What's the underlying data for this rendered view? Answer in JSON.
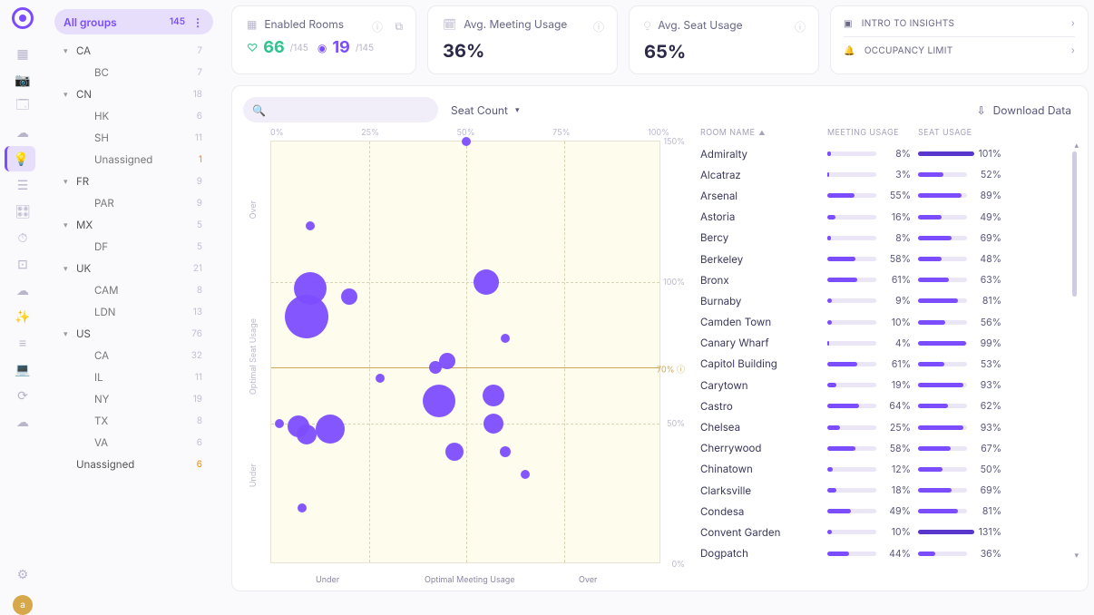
{
  "rail": {
    "avatar_letter": "a",
    "items": [
      {
        "icon": "▦",
        "name": "rooms-icon"
      },
      {
        "icon": "📷",
        "name": "camera-icon"
      },
      {
        "icon": "🗔",
        "name": "screens-icon"
      },
      {
        "icon": "☁",
        "name": "cloud1-icon"
      },
      {
        "icon": "💡",
        "name": "insights-icon",
        "selected": true
      },
      {
        "icon": "☰",
        "name": "list1-icon"
      },
      {
        "icon": "🎛",
        "name": "controls-icon"
      },
      {
        "icon": "⏱",
        "name": "time-icon"
      },
      {
        "icon": "⊡",
        "name": "box-icon"
      },
      {
        "icon": "☁",
        "name": "cloud2-icon"
      },
      {
        "icon": "✨",
        "name": "spark-icon"
      },
      {
        "icon": "≡",
        "name": "list2-icon"
      },
      {
        "icon": "💻",
        "name": "device-icon"
      },
      {
        "icon": "⟳",
        "name": "sync-icon"
      },
      {
        "icon": "☁",
        "name": "cloud3-icon"
      }
    ],
    "settings_icon": "⚙"
  },
  "tree": {
    "header": {
      "label": "All groups",
      "count": "145",
      "more": "⋮"
    },
    "items": [
      {
        "label": "CA",
        "count": "7",
        "expandable": true
      },
      {
        "label": "BC",
        "count": "7",
        "sub": true
      },
      {
        "label": "CN",
        "count": "18",
        "expandable": true
      },
      {
        "label": "HK",
        "count": "6",
        "sub": true
      },
      {
        "label": "SH",
        "count": "11",
        "sub": true
      },
      {
        "label": "Unassigned",
        "count": "1",
        "sub": true,
        "orange": true
      },
      {
        "label": "FR",
        "count": "9",
        "expandable": true
      },
      {
        "label": "PAR",
        "count": "9",
        "sub": true
      },
      {
        "label": "MX",
        "count": "5",
        "expandable": true
      },
      {
        "label": "DF",
        "count": "5",
        "sub": true
      },
      {
        "label": "UK",
        "count": "21",
        "expandable": true
      },
      {
        "label": "CAM",
        "count": "8",
        "sub": true
      },
      {
        "label": "LDN",
        "count": "13",
        "sub": true
      },
      {
        "label": "US",
        "count": "76",
        "expandable": true
      },
      {
        "label": "CA",
        "count": "32",
        "sub": true
      },
      {
        "label": "IL",
        "count": "11",
        "sub": true
      },
      {
        "label": "NY",
        "count": "19",
        "sub": true
      },
      {
        "label": "TX",
        "count": "8",
        "sub": true
      },
      {
        "label": "VA",
        "count": "6",
        "sub": true
      },
      {
        "label": "Unassigned",
        "count": "6",
        "orange": true
      }
    ]
  },
  "cards": {
    "enabled": {
      "title": "Enabled Rooms",
      "good": "66",
      "good_of": "/145",
      "bad": "19",
      "bad_of": "/145"
    },
    "meeting": {
      "title": "Avg. Meeting Usage",
      "value": "36%"
    },
    "seat": {
      "title": "Avg. Seat Usage",
      "value": "65%"
    }
  },
  "links": {
    "intro": "INTRO TO INSIGHTS",
    "occ": "OCCUPANCY LIMIT"
  },
  "toolbar": {
    "dropdown": "Seat Count",
    "download": "Download Data"
  },
  "chart_data": {
    "type": "scatter",
    "xlabel_under": "Under",
    "xlabel_mid": "Optimal Meeting Usage",
    "xlabel_over": "Over",
    "ylabel_over": "Over",
    "ylabel_mid": "Optimal Seat Usage",
    "ylabel_under": "Under",
    "xticks": [
      "0%",
      "25%",
      "50%",
      "75%",
      "100%"
    ],
    "yticks": [
      "150%",
      "100%",
      "70%",
      "50%",
      "0%"
    ],
    "threshold_label": "70% ⓘ",
    "points": [
      {
        "x": 50,
        "y": 150,
        "r": 5
      },
      {
        "x": 10,
        "y": 120,
        "r": 5
      },
      {
        "x": 10,
        "y": 98,
        "r": 18
      },
      {
        "x": 55,
        "y": 100,
        "r": 14
      },
      {
        "x": 20,
        "y": 95,
        "r": 9
      },
      {
        "x": 60,
        "y": 80,
        "r": 5
      },
      {
        "x": 9,
        "y": 88,
        "r": 24
      },
      {
        "x": 45,
        "y": 72,
        "r": 9
      },
      {
        "x": 42,
        "y": 70,
        "r": 7
      },
      {
        "x": 28,
        "y": 66,
        "r": 5
      },
      {
        "x": 43,
        "y": 58,
        "r": 18
      },
      {
        "x": 57,
        "y": 60,
        "r": 12
      },
      {
        "x": 57,
        "y": 50,
        "r": 11
      },
      {
        "x": 2,
        "y": 50,
        "r": 5
      },
      {
        "x": 7,
        "y": 49,
        "r": 12
      },
      {
        "x": 15,
        "y": 48,
        "r": 16
      },
      {
        "x": 9,
        "y": 46,
        "r": 11
      },
      {
        "x": 47,
        "y": 40,
        "r": 10
      },
      {
        "x": 60,
        "y": 40,
        "r": 6
      },
      {
        "x": 65,
        "y": 32,
        "r": 5
      },
      {
        "x": 8,
        "y": 20,
        "r": 5
      }
    ]
  },
  "table": {
    "headers": {
      "name": "ROOM NAME",
      "meeting": "MEETING USAGE",
      "seat": "SEAT USAGE",
      "sort_arrow": "▲"
    },
    "rows": [
      {
        "name": "Admiralty",
        "meeting": 8,
        "seat": 101
      },
      {
        "name": "Alcatraz",
        "meeting": 3,
        "seat": 52
      },
      {
        "name": "Arsenal",
        "meeting": 55,
        "seat": 89
      },
      {
        "name": "Astoria",
        "meeting": 16,
        "seat": 49
      },
      {
        "name": "Bercy",
        "meeting": 8,
        "seat": 69
      },
      {
        "name": "Berkeley",
        "meeting": 58,
        "seat": 48
      },
      {
        "name": "Bronx",
        "meeting": 61,
        "seat": 63
      },
      {
        "name": "Burnaby",
        "meeting": 9,
        "seat": 81
      },
      {
        "name": "Camden Town",
        "meeting": 10,
        "seat": 56
      },
      {
        "name": "Canary Wharf",
        "meeting": 4,
        "seat": 99
      },
      {
        "name": "Capitol Building",
        "meeting": 61,
        "seat": 53
      },
      {
        "name": "Carytown",
        "meeting": 19,
        "seat": 93
      },
      {
        "name": "Castro",
        "meeting": 64,
        "seat": 62
      },
      {
        "name": "Chelsea",
        "meeting": 25,
        "seat": 93
      },
      {
        "name": "Cherrywood",
        "meeting": 58,
        "seat": 67
      },
      {
        "name": "Chinatown",
        "meeting": 12,
        "seat": 50
      },
      {
        "name": "Clarksville",
        "meeting": 18,
        "seat": 69
      },
      {
        "name": "Condesa",
        "meeting": 49,
        "seat": 81
      },
      {
        "name": "Convent Garden",
        "meeting": 10,
        "seat": 131
      },
      {
        "name": "Dogpatch",
        "meeting": 44,
        "seat": 36
      }
    ]
  }
}
